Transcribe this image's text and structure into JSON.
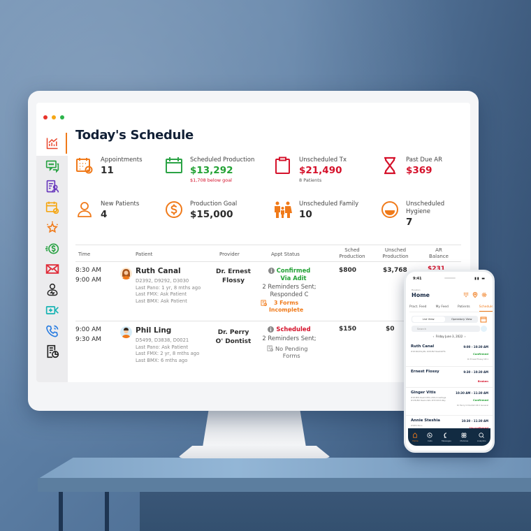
{
  "window": {
    "dots": [
      "#e8332a",
      "#f5a716",
      "#2bb34a"
    ]
  },
  "sidebar": {
    "items": [
      {
        "name": "analytics",
        "icon": "chart-icon",
        "color": "#e8452a",
        "active": true
      },
      {
        "name": "messages",
        "icon": "chat-icon",
        "color": "#2ba345"
      },
      {
        "name": "patient-forms",
        "icon": "patient-form-icon",
        "color": "#6a3bbd"
      },
      {
        "name": "scheduling",
        "icon": "calendar-check-icon",
        "color": "#f5a716"
      },
      {
        "name": "reviews",
        "icon": "star-icon",
        "color": "#f07a1a"
      },
      {
        "name": "payments",
        "icon": "dollar-icon",
        "color": "#2ba345"
      },
      {
        "name": "email",
        "icon": "mail-icon",
        "color": "#e02b38"
      },
      {
        "name": "patients",
        "icon": "person-heart-icon",
        "color": "#222222"
      },
      {
        "name": "telehealth",
        "icon": "video-icon",
        "color": "#16b3b3"
      },
      {
        "name": "calls",
        "icon": "phone-icon",
        "color": "#2a7de1"
      },
      {
        "name": "reports",
        "icon": "report-icon",
        "color": "#222222"
      }
    ]
  },
  "page": {
    "title": "Today's Schedule"
  },
  "stats": [
    {
      "label": "Appointments",
      "value": "11",
      "icon": "calendar-check-icon"
    },
    {
      "label": "Scheduled Production",
      "value": "$13,292",
      "sub": "$1,708 below goal",
      "icon": "calendar-icon"
    },
    {
      "label": "Unscheduled Tx",
      "value": "$21,490",
      "sub": "8 Patients",
      "icon": "clipboard-icon"
    },
    {
      "label": "Past Due AR",
      "value": "$369",
      "icon": "hourglass-icon"
    },
    {
      "label": "New Patients",
      "value": "4",
      "icon": "user-icon"
    },
    {
      "label": "Production Goal",
      "value": "$15,000",
      "icon": "dollar-circle-icon"
    },
    {
      "label": "Unscheduled Family",
      "value": "10",
      "icon": "family-icon"
    },
    {
      "label": "Unscheduled Hygiene",
      "value": "7",
      "icon": "smile-icon"
    }
  ],
  "table": {
    "headers": {
      "time": "Time",
      "patient": "Patient",
      "provider": "Provider",
      "status": "Appt Status",
      "sched1": "Sched",
      "sched2": "Production",
      "unsched1": "Unsched",
      "unsched2": "Production",
      "ar1": "AR",
      "ar2": "Balance"
    },
    "rows": [
      {
        "start": "8:30 AM",
        "end": "9:00 AM",
        "patient": "Ruth Canal",
        "codes": "D2392, D9292, D3030",
        "pano": "Last Pano: 1 yr, 8 mths ago",
        "fmx": "Last FMX: Ask Patient",
        "bmx": "Last BMX: Ask Patient",
        "provider1": "Dr. Ernest",
        "provider2": "Flossy",
        "status1": "Confirmed",
        "status2": "Via Adit",
        "reminders1": "2 Reminders Sent;",
        "reminders2": "Responded C",
        "forms1": "3 Forms",
        "forms2": "Incomplete",
        "sched": "$800",
        "unsched": "$3,768",
        "ar": "$231"
      },
      {
        "start": "9:00 AM",
        "end": "9:30 AM",
        "patient": "Phil Ling",
        "codes": "D5499, D3838, D0021",
        "pano": "Last Pano: Ask Patient",
        "fmx": "Last FMX: 2 yr, 8 mths ago",
        "bmx": "Last BMX: 6 mths ago",
        "provider1": "Dr. Perry",
        "provider2": "O' Dontist",
        "status1": "Scheduled",
        "reminders1": "2 Reminders Sent;",
        "forms1": "No Pending",
        "forms2": "Forms",
        "sched": "$150",
        "unsched": "$0"
      }
    ]
  },
  "phone": {
    "time": "9:41",
    "location": "Houston",
    "title": "Home",
    "tabs": [
      "Pract. Feed",
      "My Feed",
      "Patients",
      "Schedule"
    ],
    "active_tab": "Schedule",
    "view_toggle": [
      "List View",
      "Operatory View"
    ],
    "search_placeholder": "Search",
    "date": "Friday June 3, 2022",
    "appointments": [
      {
        "name": "Ruth Canal",
        "time": "9:00 - 10:30 AM",
        "codes": "#18-NO/PolyMu #28-BVI NewDAFTs",
        "status": "Confirmed",
        "provider": "Dr Ernest Flossy OP-1"
      },
      {
        "name": "Ernest Flossy",
        "time": "9:30 - 10:30 AM",
        "codes": "",
        "status": "Broken",
        "provider": ""
      },
      {
        "name": "Ginger Vitis",
        "time": "10:30 AM - 11:30 AM",
        "codes": "#18-MID-ResCmPDL #29-Crowltega #138-BVI ResComPo #33 tdhlt Way",
        "status": "Confirmed",
        "provider": "Dr Perry O Dontist OP-2 General"
      },
      {
        "name": "Annie Steshia",
        "time": "10:30 - 11:30 AM",
        "codes": "LTOEX Pano",
        "status": "Unconfirmed",
        "provider": ""
      }
    ],
    "nav": [
      "Home",
      "Calls",
      "Messages",
      "Modules",
      "Analytics"
    ]
  }
}
